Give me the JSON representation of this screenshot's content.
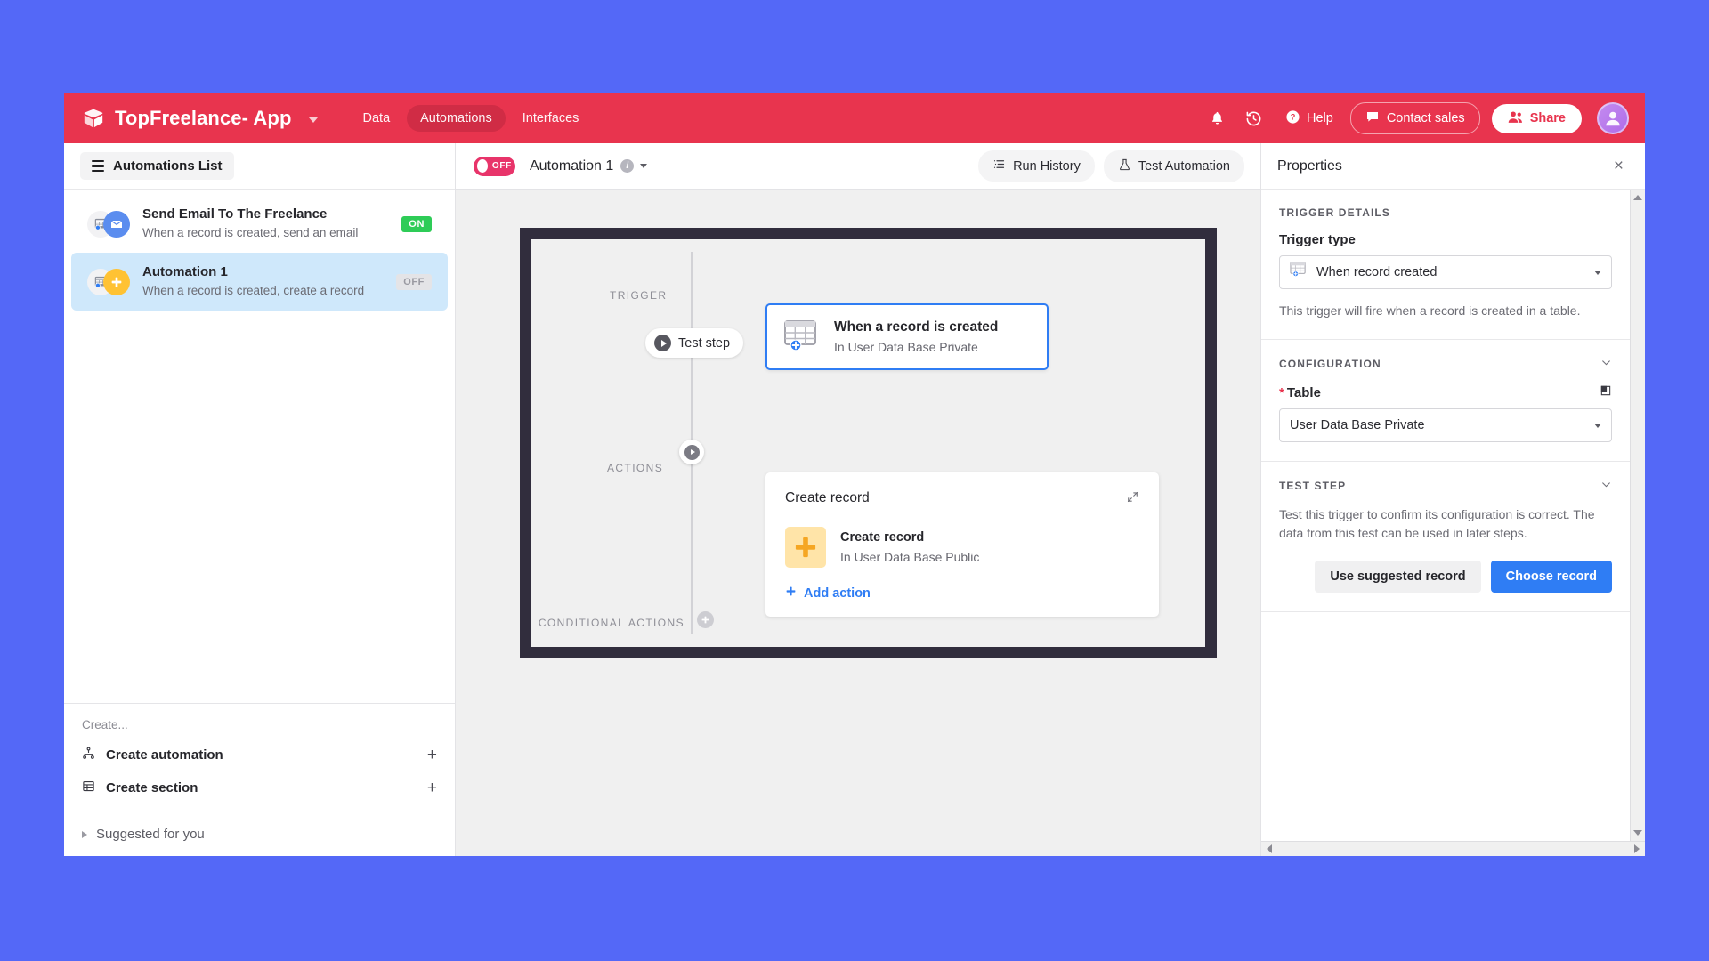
{
  "topbar": {
    "logo_icon": "cube-logo-icon",
    "app_name": "TopFreelance- App",
    "nav": [
      {
        "label": "Data",
        "active": false
      },
      {
        "label": "Automations",
        "active": true
      },
      {
        "label": "Interfaces",
        "active": false
      }
    ],
    "notifications_icon": "bell-icon",
    "history_icon": "history-clock-icon",
    "help_label": "Help",
    "help_icon": "question-circle-icon",
    "contact_sales_label": "Contact sales",
    "contact_sales_icon": "chat-bubble-icon",
    "share_label": "Share",
    "share_icon": "users-icon",
    "avatar_icon": "user-avatar-icon",
    "brand_color": "#e8344e"
  },
  "sidebar": {
    "header_label": "Automations List",
    "header_icon": "hamburger-icon",
    "automations": [
      {
        "title": "Send Email To The Freelance",
        "subtitle": "When a record is created, send an email",
        "status": "ON",
        "status_color": "#2ecc57",
        "icon_primary": "table-record-icon",
        "icon_secondary": "envelope-icon",
        "selected": false
      },
      {
        "title": "Automation 1",
        "subtitle": "When a record is created, create a record",
        "status": "OFF",
        "status_color": "#9a9aa2",
        "icon_primary": "table-record-icon",
        "icon_secondary": "plus-square-icon",
        "selected": true
      }
    ],
    "create_label": "Create...",
    "create_items": [
      {
        "label": "Create automation",
        "icon": "sitemap-icon",
        "add": "+"
      },
      {
        "label": "Create section",
        "icon": "grid-table-icon",
        "add": "+"
      }
    ],
    "suggested_label": "Suggested for you",
    "suggested_icon": "triangle-right-icon"
  },
  "canvas": {
    "toggle_label": "OFF",
    "toggle_on": false,
    "automation_name": "Automation 1",
    "info_icon": "info-icon",
    "name_caret_icon": "chevron-down-icon",
    "run_history_label": "Run History",
    "run_history_icon": "list-lines-icon",
    "test_automation_label": "Test Automation",
    "test_automation_icon": "flask-icon",
    "labels": {
      "trigger": "TRIGGER",
      "actions": "ACTIONS",
      "conditional_actions": "CONDITIONAL ACTIONS"
    },
    "test_step_label": "Test step",
    "test_step_icon": "play-icon",
    "action_play_icon": "play-icon",
    "conditional_add_icon": "plus-circle-icon",
    "trigger_card": {
      "title": "When a record is created",
      "subtitle": "In User Data Base Private",
      "icon": "table-record-created-icon",
      "selected_border": "#2f7df4"
    },
    "action_card": {
      "heading": "Create record",
      "expand_icon": "collapse-arrows-icon",
      "item_title": "Create record",
      "item_subtitle": "In User Data Base Public",
      "item_icon": "plus-icon",
      "item_icon_bg": "#ffe4a8",
      "add_action_label": "Add action",
      "add_action_icon": "plus-icon"
    }
  },
  "properties": {
    "title": "Properties",
    "close_icon": "close-icon",
    "trigger_details": {
      "section_label": "TRIGGER DETAILS",
      "field_label": "Trigger type",
      "value": "When record created",
      "value_icon": "table-record-created-icon",
      "caret_icon": "chevron-down-icon",
      "help_text": "This trigger will fire when a record is created in a table."
    },
    "configuration": {
      "section_label": "CONFIGURATION",
      "collapse_icon": "chevron-down-icon",
      "field_label": "Table",
      "required_mark": "*",
      "expand_icon": "open-panel-icon",
      "value": "User Data Base Private",
      "caret_icon": "chevron-down-icon"
    },
    "test_step": {
      "section_label": "TEST STEP",
      "collapse_icon": "chevron-down-icon",
      "help_text": "Test this trigger to confirm its configuration is correct. The data from this test can be used in later steps.",
      "secondary_button": "Use suggested record",
      "primary_button": "Choose record",
      "primary_color": "#2f7df4"
    },
    "vertical_scrollbar": {
      "up_icon": "arrow-up-icon",
      "down_icon": "arrow-down-icon"
    },
    "horizontal_scrollbar": {
      "left_icon": "arrow-left-icon",
      "right_icon": "arrow-right-icon"
    }
  }
}
